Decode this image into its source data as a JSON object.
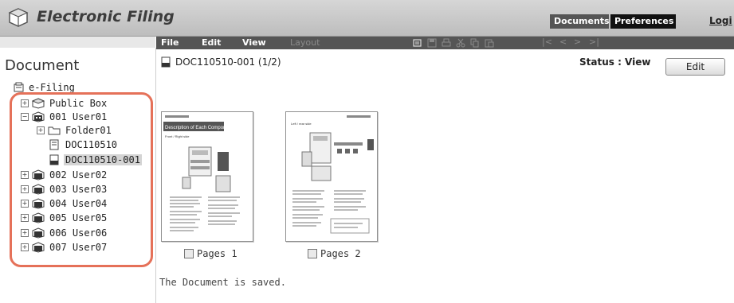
{
  "header": {
    "app_title": "Electronic Filing",
    "tabs": [
      {
        "label": "Documents"
      },
      {
        "label": "Preferences"
      }
    ],
    "login_label": "Logi"
  },
  "menubar": {
    "menus": [
      "File",
      "Edit",
      "View",
      "Layout"
    ],
    "toolbar_icons": [
      "properties-icon",
      "save-icon",
      "print-icon",
      "cut-icon",
      "copy-icon",
      "paste-icon"
    ],
    "nav_icons": [
      "first-page-icon",
      "prev-page-icon",
      "next-page-icon",
      "last-page-icon"
    ]
  },
  "sidebar": {
    "title": "Document",
    "root_label": "e-Filing",
    "tree": [
      {
        "label": "Public Box",
        "icon": "box-icon",
        "expander": "+"
      },
      {
        "label": "001 User01",
        "icon": "user-box-icon",
        "expander": "−"
      },
      {
        "label": "Folder01",
        "icon": "folder-icon",
        "expander": "+"
      },
      {
        "label": "DOC110510",
        "icon": "document-icon"
      },
      {
        "label": "DOC110510-001",
        "icon": "document-icon",
        "selected": true
      },
      {
        "label": "002 User02",
        "icon": "user-box-icon",
        "expander": "+"
      },
      {
        "label": "003 User03",
        "icon": "user-box-icon",
        "expander": "+"
      },
      {
        "label": "004 User04",
        "icon": "user-box-icon",
        "expander": "+"
      },
      {
        "label": "005 User05",
        "icon": "user-box-icon",
        "expander": "+"
      },
      {
        "label": "006 User06",
        "icon": "user-box-icon",
        "expander": "+"
      },
      {
        "label": "007 User07",
        "icon": "user-box-icon",
        "expander": "+"
      }
    ]
  },
  "main": {
    "doc_title": "DOC110510-001 (1/2)",
    "status": "Status : View",
    "edit_label": "Edit",
    "pages": [
      {
        "caption": "Pages 1",
        "page_heading": "Description of Each Component",
        "page_subheading": "Front / Right side"
      },
      {
        "caption": "Pages 2",
        "page_heading": "",
        "page_subheading": "Left / rear side"
      }
    ],
    "message": "The Document is saved."
  },
  "colors": {
    "highlight": "#e57159",
    "menubar": "#555555",
    "selected_row": "#d4d4d4",
    "documents_tab": "#555555",
    "preferences_tab": "#111111"
  }
}
